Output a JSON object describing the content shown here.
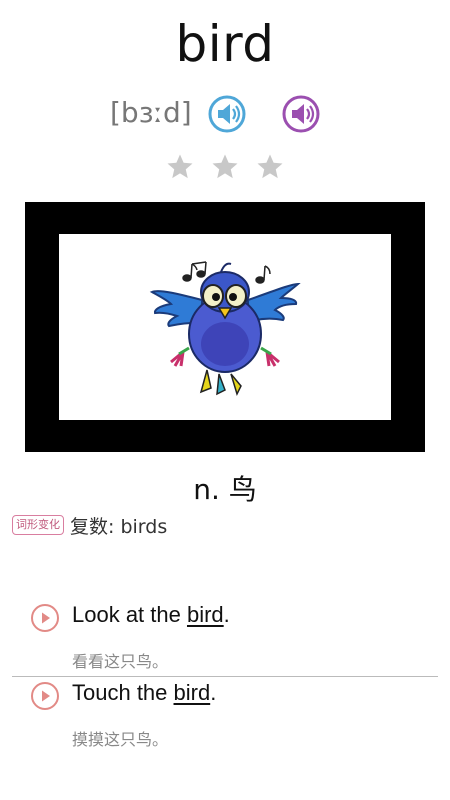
{
  "word": "bird",
  "phonetic": "[bɜːd]",
  "icons": {
    "uk_speaker": "speaker-icon",
    "us_speaker": "speaker-icon",
    "play": "play-icon",
    "star": "star-icon"
  },
  "colors": {
    "uk_speaker": "#4fa7d8",
    "us_speaker": "#9b4fb0",
    "star": "#c8c8c8",
    "play": "#e28a86",
    "badge": "#c05a7d"
  },
  "rating": {
    "filled": 0,
    "total": 3
  },
  "meaning": "n. 鸟",
  "forms": {
    "badge": "词形变化",
    "text": "复数: birds"
  },
  "examples": [
    {
      "pre": "Look at the ",
      "word": "bird",
      "post": ".",
      "translation": "看看这只鸟。"
    },
    {
      "pre": "Touch the ",
      "word": "bird",
      "post": ".",
      "translation": "摸摸这只鸟。"
    }
  ]
}
